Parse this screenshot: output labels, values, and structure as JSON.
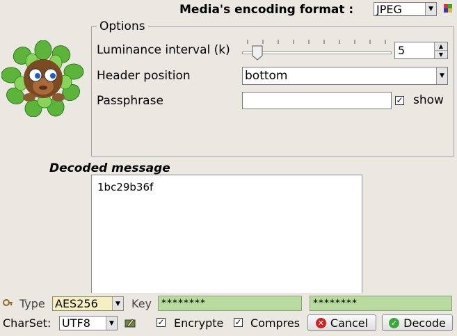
{
  "format": {
    "label": "Media's encoding format :",
    "value": "JPEG"
  },
  "options": {
    "legend": "Options",
    "luminance": {
      "label": "Luminance interval (k)",
      "value": "5",
      "slider_level": 0.1
    },
    "header_position": {
      "label": "Header position",
      "value": "bottom"
    },
    "passphrase": {
      "label": "Passphrase",
      "value": "",
      "show_label": "show",
      "show_checked": true
    }
  },
  "decoded": {
    "label": "Decoded message",
    "text": "1bc29b36f"
  },
  "bottom": {
    "type_label": "Type",
    "type_value": "AES256",
    "key_label": "Key",
    "key1": "********",
    "key2": "********",
    "charset_label": "CharSet:",
    "charset_value": "UTF8",
    "encrypted_label": "Encrypte",
    "encrypted_checked": true,
    "compress_label": "Compres",
    "compress_checked": true,
    "cancel_label": "Cancel",
    "decode_label": "Decode"
  },
  "colors": {
    "key_field": "#b9dba0",
    "type_field": "#f5efc2",
    "cancel_icon": "#d22020",
    "decode_icon": "#3aa83a"
  }
}
